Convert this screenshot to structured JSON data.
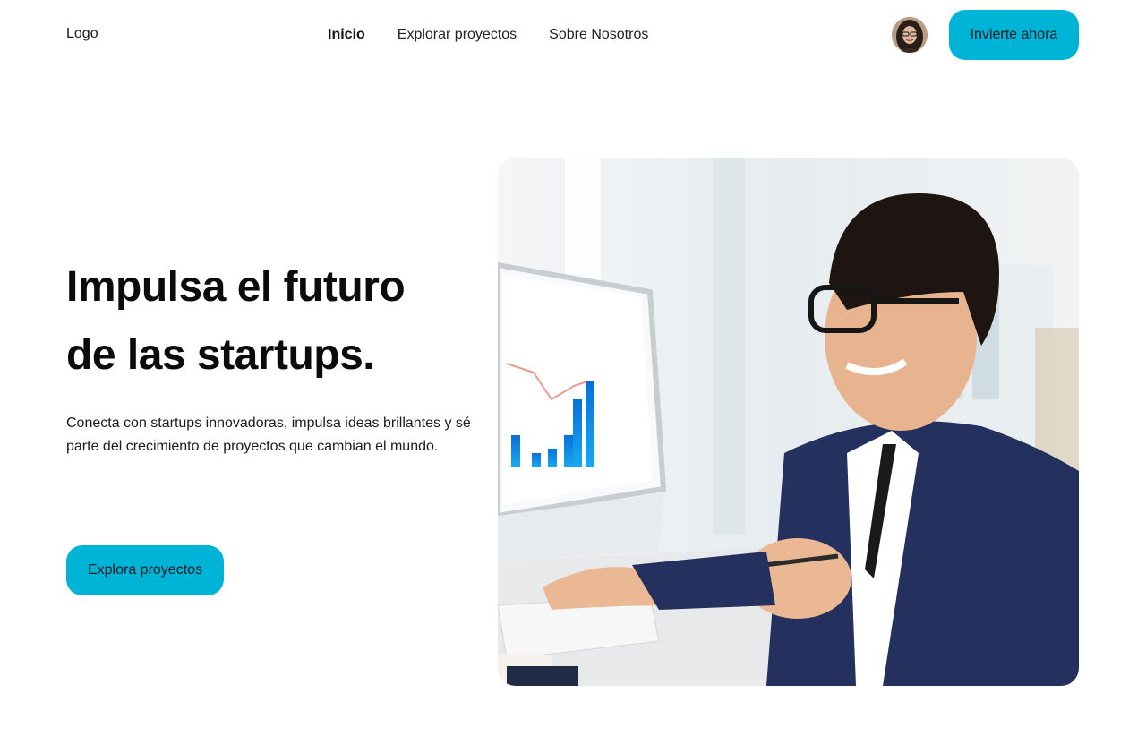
{
  "header": {
    "logo": "Logo",
    "nav": [
      {
        "label": "Inicio",
        "active": true
      },
      {
        "label": "Explorar proyectos",
        "active": false
      },
      {
        "label": "Sobre Nosotros",
        "active": false
      }
    ],
    "cta_label": "Invierte ahora"
  },
  "hero": {
    "title_line1": "Impulsa el futuro",
    "title_line2": "de las startups.",
    "description": "Conecta con startups innovadoras, impulsa ideas brillantes y sé parte del crecimiento de proyectos que cambian el mundo.",
    "cta_label": "Explora proyectos"
  },
  "colors": {
    "accent": "#00b4d8",
    "text": "#111111",
    "background": "#ffffff"
  }
}
